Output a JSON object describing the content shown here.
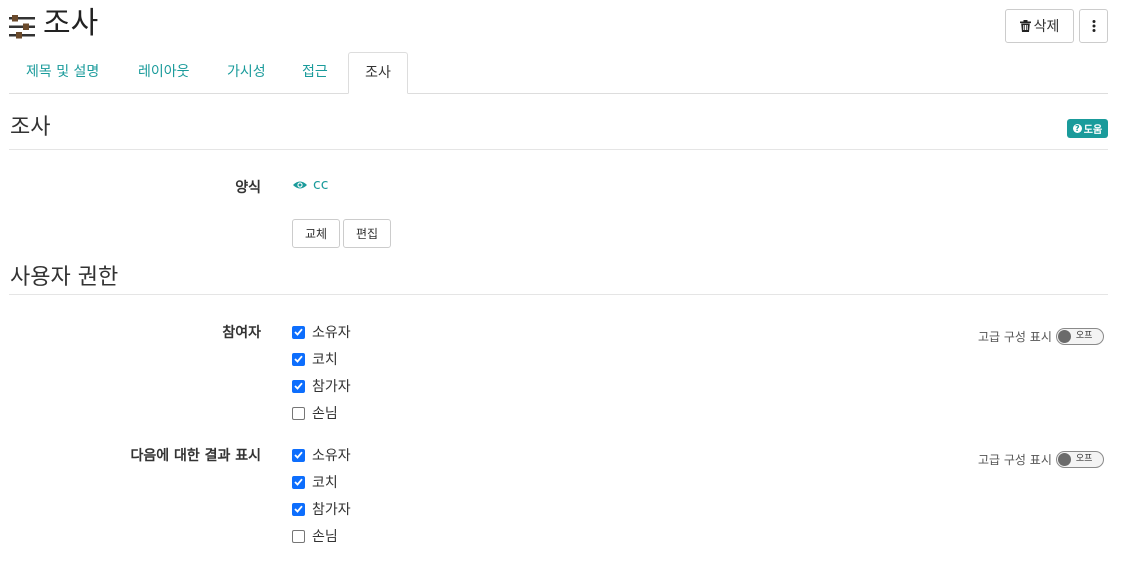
{
  "header": {
    "title": "조사",
    "delete_label": "삭제"
  },
  "tabs": [
    {
      "label": "제목 및 설명",
      "active": false
    },
    {
      "label": "레이아웃",
      "active": false
    },
    {
      "label": "가시성",
      "active": false
    },
    {
      "label": "접근",
      "active": false
    },
    {
      "label": "조사",
      "active": true
    }
  ],
  "survey_section": {
    "title": "조사",
    "help_label": "도움",
    "form_label": "양식",
    "form_link": "cc",
    "replace_label": "교체",
    "edit_label": "편집"
  },
  "permissions_section": {
    "title": "사용자 권한",
    "groups": [
      {
        "label": "참여자",
        "advanced_label": "고급 구성 표시",
        "toggle_label": "오프",
        "options": [
          {
            "label": "소유자",
            "checked": true
          },
          {
            "label": "코치",
            "checked": true
          },
          {
            "label": "참가자",
            "checked": true
          },
          {
            "label": "손님",
            "checked": false
          }
        ]
      },
      {
        "label": "다음에 대한 결과 표시",
        "advanced_label": "고급 구성 표시",
        "toggle_label": "오프",
        "options": [
          {
            "label": "소유자",
            "checked": true
          },
          {
            "label": "코치",
            "checked": true
          },
          {
            "label": "참가자",
            "checked": true
          },
          {
            "label": "손님",
            "checked": false
          }
        ]
      }
    ]
  },
  "colors": {
    "accent": "#1a9b9b",
    "checkbox": "#0d6efd"
  }
}
